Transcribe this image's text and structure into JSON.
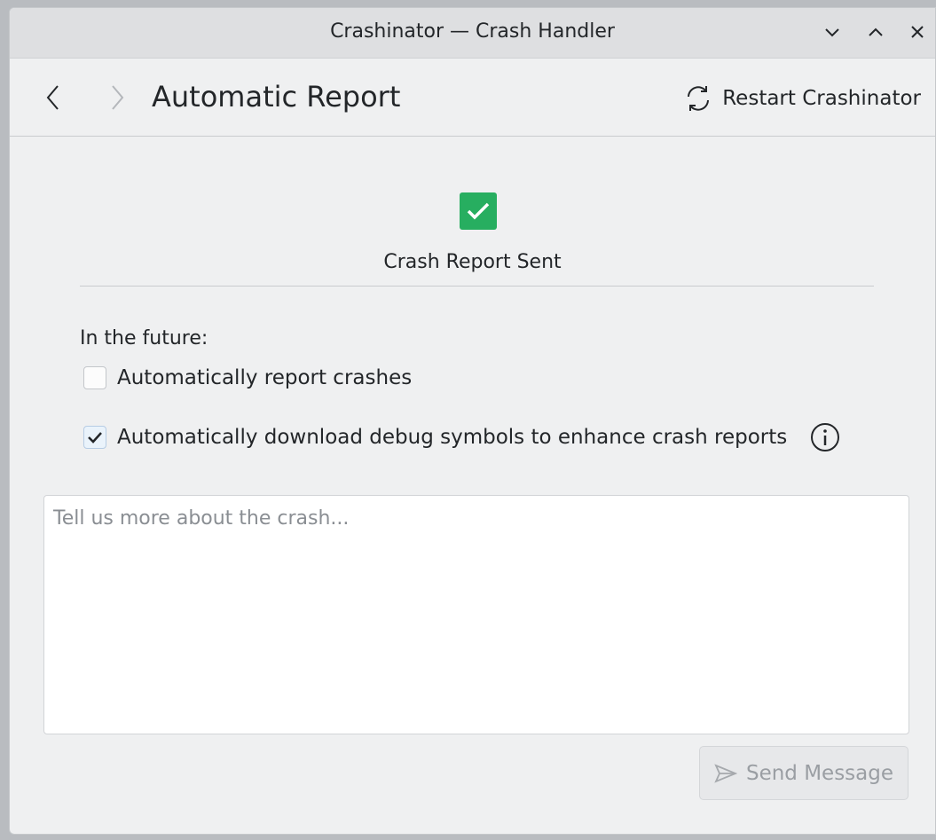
{
  "window": {
    "title": "Crashinator — Crash Handler",
    "controls": [
      "minimize-icon",
      "maximize-icon",
      "close-icon"
    ]
  },
  "header": {
    "back_icon": "chevron-left-icon",
    "forward_icon": "chevron-right-icon",
    "page_title": "Automatic Report",
    "restart_label": "Restart Crashinator",
    "restart_icon": "refresh-icon"
  },
  "status": {
    "icon": "checkmark-icon",
    "text": "Crash Report Sent",
    "color": "#27ae60"
  },
  "options": {
    "heading": "In the future:",
    "auto_report": {
      "label": "Automatically report crashes",
      "checked": false
    },
    "debug_symbols": {
      "label": "Automatically download debug symbols to enhance crash reports",
      "checked": true,
      "info_icon": "info-icon"
    }
  },
  "message": {
    "placeholder": "Tell us more about the crash...",
    "value": ""
  },
  "send": {
    "label": "Send Message",
    "icon": "send-icon",
    "enabled": false
  }
}
